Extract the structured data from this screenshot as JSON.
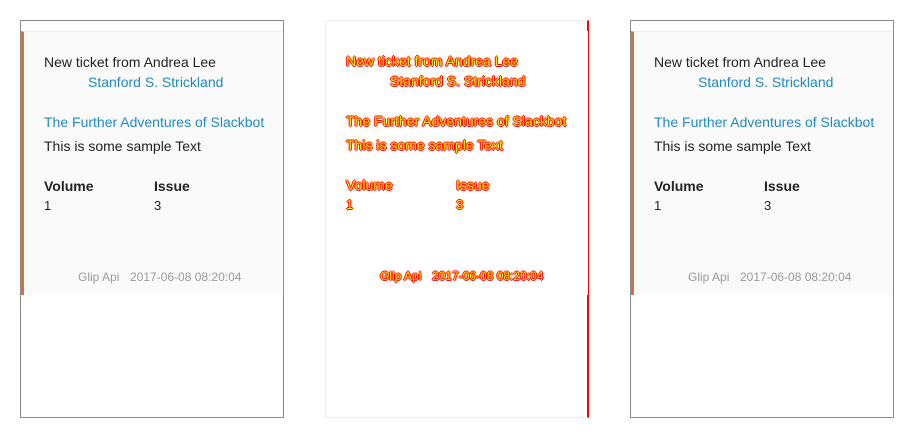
{
  "card": {
    "title": "New ticket from Andrea Lee",
    "author": "Stanford S. Strickland",
    "headline": "The Further Adventures of Slackbot",
    "body": "This is some sample Text",
    "fields": [
      {
        "label": "Volume",
        "value": "1"
      },
      {
        "label": "Issue",
        "value": "3"
      }
    ],
    "footer_source": "Glip Api",
    "footer_time": "2017-06-08 08:20:04"
  },
  "colors": {
    "accent": "#d4713a",
    "link": "#1f8ac0",
    "diff_fill": "#ffee00",
    "diff_outline": "#ff0000"
  }
}
